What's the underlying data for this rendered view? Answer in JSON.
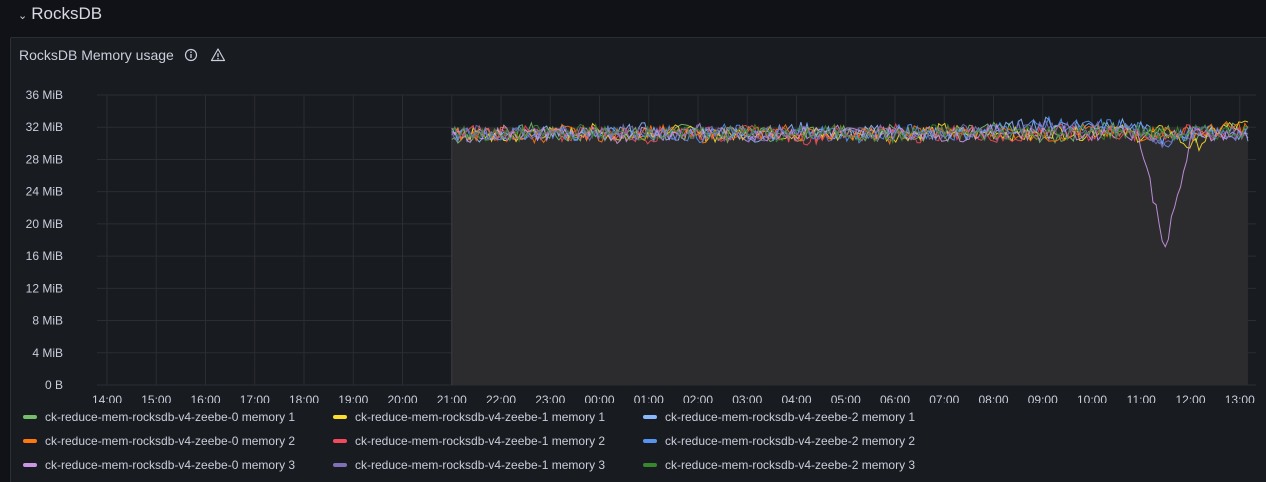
{
  "row": {
    "title": "RocksDB"
  },
  "panel": {
    "title": "RocksDB Memory usage",
    "info_icon": "info-icon",
    "warning_icon": "warning-icon"
  },
  "chart_data": {
    "type": "line",
    "title": "RocksDB Memory usage",
    "xlabel": "",
    "ylabel": "",
    "x_ticks": [
      "14:00",
      "15:00",
      "16:00",
      "17:00",
      "18:00",
      "19:00",
      "20:00",
      "21:00",
      "22:00",
      "23:00",
      "00:00",
      "01:00",
      "02:00",
      "03:00",
      "04:00",
      "05:00",
      "06:00",
      "07:00",
      "08:00",
      "09:00",
      "10:00",
      "11:00",
      "12:00",
      "13:00"
    ],
    "y_ticks": [
      "0 B",
      "4 MiB",
      "8 MiB",
      "12 MiB",
      "16 MiB",
      "20 MiB",
      "24 MiB",
      "28 MiB",
      "32 MiB",
      "36 MiB"
    ],
    "ylim_mib": [
      0,
      36
    ],
    "grid": true,
    "legend_position": "bottom",
    "data_start": "21:00",
    "data_end": "13:10",
    "series": [
      {
        "name": "ck-reduce-mem-rocksdb-v4-zeebe-0 memory 1",
        "color": "#73bf69",
        "values_mib": [
          30.5,
          31.5,
          31.0,
          31.8,
          30.8,
          31.2,
          31.6,
          30.9,
          31.4,
          31.7,
          31.0,
          31.5,
          30.8,
          31.3,
          31.9,
          31.0,
          31.6,
          31.2,
          30.9,
          31.5,
          31.8,
          31.1,
          30.7,
          31.4,
          32.0,
          31.3,
          31.5,
          31.0,
          31.6,
          31.8
        ]
      },
      {
        "name": "ck-reduce-mem-rocksdb-v4-zeebe-1 memory 1",
        "color": "#fade2a",
        "values_mib": [
          31.0,
          31.2,
          30.6,
          31.5,
          31.0,
          31.7,
          30.8,
          31.3,
          31.5,
          31.1,
          30.9,
          31.6,
          31.2,
          31.4,
          30.8,
          31.5,
          31.0,
          31.3,
          31.7,
          31.1,
          31.4,
          30.9,
          31.6,
          31.2,
          31.8,
          31.0,
          31.5,
          29.5,
          31.9,
          32.2
        ]
      },
      {
        "name": "ck-reduce-mem-rocksdb-v4-zeebe-2 memory 1",
        "color": "#8ab8ff",
        "values_mib": [
          31.2,
          30.8,
          31.5,
          31.1,
          31.6,
          30.9,
          31.3,
          31.7,
          31.0,
          31.4,
          31.2,
          30.8,
          31.5,
          31.9,
          31.1,
          31.3,
          31.6,
          31.0,
          31.4,
          31.2,
          31.7,
          32.3,
          32.5,
          32.1,
          32.4,
          31.9,
          30.5,
          31.6,
          31.2,
          31.0
        ]
      },
      {
        "name": "ck-reduce-mem-rocksdb-v4-zeebe-0 memory 2",
        "color": "#ff780a",
        "values_mib": [
          31.4,
          31.0,
          31.3,
          30.7,
          31.5,
          31.2,
          30.9,
          31.6,
          31.3,
          30.8,
          31.5,
          31.1,
          31.7,
          31.0,
          31.4,
          31.2,
          30.8,
          31.6,
          31.3,
          31.0,
          31.5,
          31.2,
          30.9,
          31.7,
          31.3,
          31.0,
          31.5,
          31.2,
          31.8,
          32.0
        ]
      },
      {
        "name": "ck-reduce-mem-rocksdb-v4-zeebe-1 memory 2",
        "color": "#f2495c",
        "values_mib": [
          30.9,
          31.6,
          31.1,
          31.4,
          30.8,
          31.5,
          31.2,
          30.7,
          31.6,
          31.3,
          31.0,
          31.5,
          31.2,
          30.6,
          31.4,
          31.1,
          31.7,
          30.9,
          31.3,
          31.5,
          30.4,
          31.2,
          31.6,
          31.0,
          31.4,
          30.8,
          31.2,
          31.5,
          31.0,
          31.3
        ]
      },
      {
        "name": "ck-reduce-mem-rocksdb-v4-zeebe-2 memory 2",
        "color": "#5794f2",
        "values_mib": [
          31.1,
          31.3,
          31.0,
          31.6,
          31.2,
          30.9,
          31.5,
          31.1,
          31.4,
          30.9,
          31.6,
          31.2,
          31.0,
          31.5,
          31.3,
          30.8,
          31.4,
          31.6,
          31.1,
          31.3,
          31.9,
          32.2,
          32.4,
          32.0,
          32.3,
          31.8,
          30.2,
          31.4,
          31.1,
          31.2
        ]
      },
      {
        "name": "ck-reduce-mem-rocksdb-v4-zeebe-0 memory 3",
        "color": "#ca95e5",
        "values_mib": [
          31.3,
          30.9,
          31.6,
          31.0,
          31.4,
          31.2,
          30.8,
          31.5,
          31.1,
          31.6,
          31.3,
          30.9,
          31.4,
          31.2,
          31.7,
          31.0,
          31.3,
          31.5,
          30.9,
          31.2,
          31.6,
          31.1,
          31.4,
          31.0,
          31.5,
          31.2,
          17.0,
          31.4,
          31.1,
          31.3
        ]
      },
      {
        "name": "ck-reduce-mem-rocksdb-v4-zeebe-1 memory 3",
        "color": "#806eb7",
        "values_mib": [
          31.0,
          31.4,
          31.2,
          30.8,
          31.5,
          31.1,
          31.6,
          31.0,
          31.3,
          31.5,
          31.1,
          30.9,
          31.6,
          31.2,
          31.0,
          31.5,
          31.3,
          30.8,
          31.4,
          31.6,
          31.2,
          31.8,
          32.0,
          31.6,
          31.9,
          31.3,
          30.0,
          31.5,
          31.2,
          31.4
        ]
      },
      {
        "name": "ck-reduce-mem-rocksdb-v4-zeebe-2 memory 3",
        "color": "#37872d",
        "values_mib": [
          31.5,
          31.1,
          30.9,
          31.4,
          31.2,
          31.7,
          31.0,
          31.3,
          30.8,
          31.5,
          31.2,
          31.6,
          30.9,
          31.3,
          31.5,
          31.1,
          30.8,
          31.4,
          31.6,
          31.0,
          31.3,
          31.5,
          31.1,
          31.4,
          31.2,
          31.6,
          31.0,
          31.5,
          31.3,
          31.6
        ]
      }
    ]
  }
}
